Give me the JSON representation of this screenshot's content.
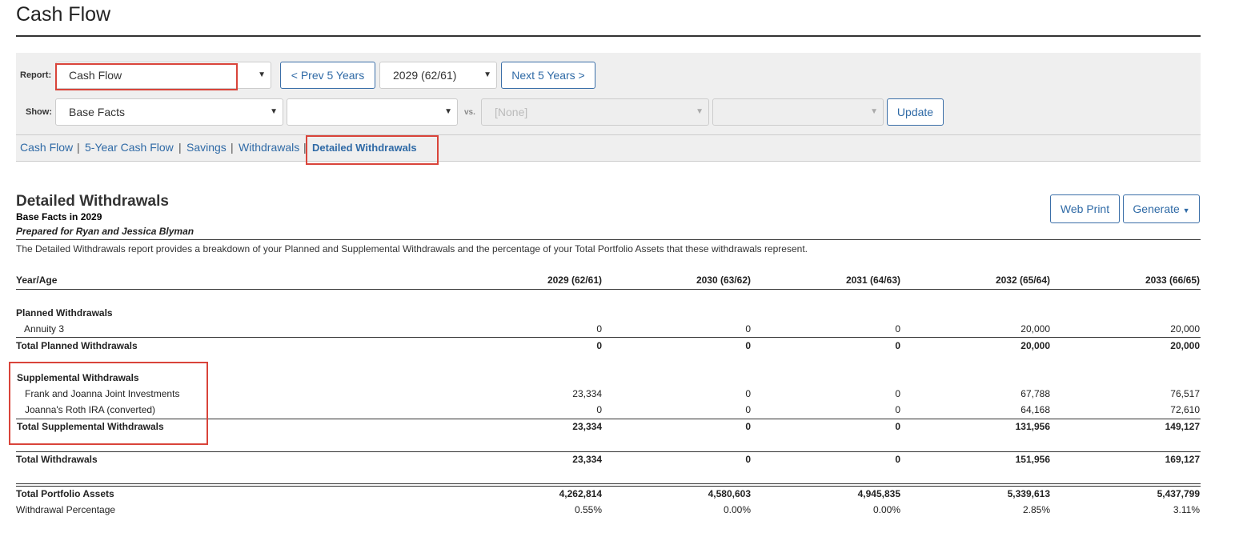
{
  "header": {
    "title": "Cash Flow"
  },
  "toolbar": {
    "report_label": "Report:",
    "report_value": "Cash Flow",
    "prev_label": "< Prev 5 Years",
    "year_value": "2029 (62/61)",
    "next_label": "Next 5 Years >",
    "show_label": "Show:",
    "show_value": "Base Facts",
    "show_second_value": "",
    "vs_label": "vs.",
    "vs_value": "[None]",
    "vs_second_value": "",
    "update_label": "Update"
  },
  "tabs": [
    {
      "label": "Cash Flow"
    },
    {
      "label": "5-Year Cash Flow"
    },
    {
      "label": "Savings"
    },
    {
      "label": "Withdrawals"
    },
    {
      "label": "Detailed Withdrawals",
      "active": true
    }
  ],
  "tab_separator": "|",
  "report": {
    "title": "Detailed Withdrawals",
    "subtitle": "Base Facts in 2029",
    "prepared_for": "Prepared for Ryan and Jessica Blyman",
    "description": "The Detailed Withdrawals report provides a breakdown of your Planned and Supplemental Withdrawals and the percentage of your Total Portfolio Assets that these withdrawals represent.",
    "web_print_label": "Web Print",
    "generate_label": "Generate"
  },
  "table": {
    "header_label": "Year/Age",
    "columns": [
      "2029 (62/61)",
      "2030 (63/62)",
      "2031 (64/63)",
      "2032 (65/64)",
      "2033 (66/65)"
    ],
    "planned_heading": "Planned Withdrawals",
    "annuity": {
      "label": "Annuity 3",
      "values": [
        "0",
        "0",
        "0",
        "20,000",
        "20,000"
      ]
    },
    "total_planned": {
      "label": "Total Planned Withdrawals",
      "values": [
        "0",
        "0",
        "0",
        "20,000",
        "20,000"
      ]
    },
    "supplemental_heading": "Supplemental Withdrawals",
    "joint": {
      "label": "Frank and Joanna Joint Investments",
      "values": [
        "23,334",
        "0",
        "0",
        "67,788",
        "76,517"
      ]
    },
    "roth": {
      "label": "Joanna's Roth IRA (converted)",
      "values": [
        "0",
        "0",
        "0",
        "64,168",
        "72,610"
      ]
    },
    "total_supplemental": {
      "label": "Total Supplemental Withdrawals",
      "values": [
        "23,334",
        "0",
        "0",
        "131,956",
        "149,127"
      ]
    },
    "total_withdrawals": {
      "label": "Total Withdrawals",
      "values": [
        "23,334",
        "0",
        "0",
        "151,956",
        "169,127"
      ]
    },
    "total_assets": {
      "label": "Total Portfolio Assets",
      "values": [
        "4,262,814",
        "4,580,603",
        "4,945,835",
        "5,339,613",
        "5,437,799"
      ]
    },
    "withdrawal_pct": {
      "label": "Withdrawal Percentage",
      "values": [
        "0.55%",
        "0.00%",
        "0.00%",
        "2.85%",
        "3.11%"
      ]
    }
  }
}
